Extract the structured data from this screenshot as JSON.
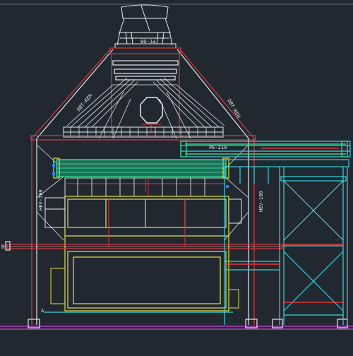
{
  "canvas": {
    "background": "#212830"
  },
  "colors": {
    "white": "#e8eaec",
    "red": "#e03a3a",
    "yellow": "#e8e23a",
    "cyan": "#35d6e0",
    "green": "#2fd38c",
    "magenta": "#c84ad8",
    "blue": "#3a7dff"
  },
  "labels": {
    "fan_tag": "FC-08",
    "pipe_main": "PE-210",
    "riser_right": "HEV-100",
    "riser_left": "HEV-100",
    "duct_right": "DBT-KEH",
    "duct_left": "DBT-KEH",
    "base_marker": "A",
    "left_marker": "H"
  }
}
